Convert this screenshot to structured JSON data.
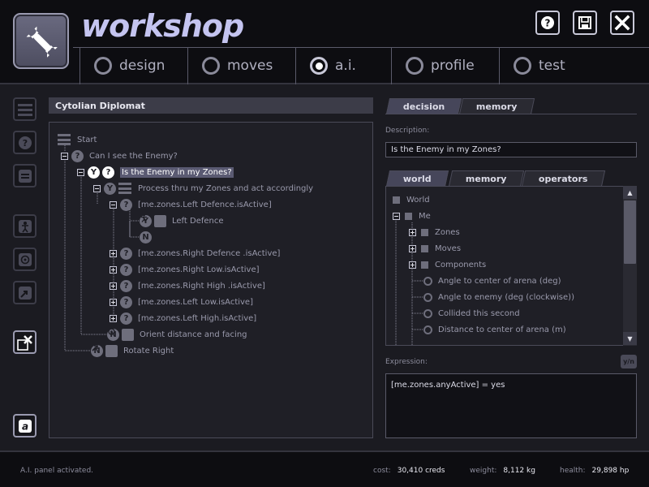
{
  "app": {
    "title": "workshop"
  },
  "header": {
    "help_icon": "help-icon",
    "save_icon": "save-icon",
    "close_icon": "close-icon"
  },
  "nav": {
    "tabs": [
      {
        "label": "design",
        "active": false
      },
      {
        "label": "moves",
        "active": false
      },
      {
        "label": "a.i.",
        "active": true
      },
      {
        "label": "profile",
        "active": false
      },
      {
        "label": "test",
        "active": false
      }
    ]
  },
  "toolbar": {
    "icons": [
      "list-icon",
      "question-icon",
      "equals-icon",
      "figure-icon",
      "target-icon",
      "action-icon",
      "delete-icon",
      "a-icon"
    ]
  },
  "tree": {
    "title": "Cytolian Diplomat",
    "rows": [
      {
        "text": "Start"
      },
      {
        "text": "Can I see the Enemy?"
      },
      {
        "text": "Is the Enemy in my Zones?"
      },
      {
        "text": "Process thru my Zones and act accordingly"
      },
      {
        "text": "[me.zones.Left Defence.isActive]"
      },
      {
        "text": "Left Defence"
      },
      {
        "text": ""
      },
      {
        "text": "[me.zones.Right Defence .isActive]"
      },
      {
        "text": "[me.zones.Right Low.isActive]"
      },
      {
        "text": "[me.zones.Right High .isActive]"
      },
      {
        "text": "[me.zones.Left Low.isActive]"
      },
      {
        "text": "[me.zones.Left High.isActive]"
      },
      {
        "text": "Orient distance and facing"
      },
      {
        "text": "Rotate Right"
      }
    ],
    "badges": {
      "y": "Y",
      "n": "N",
      "q": "?"
    }
  },
  "right": {
    "top_tabs": [
      {
        "label": "decision",
        "active": true
      },
      {
        "label": "memory",
        "active": false
      }
    ],
    "description_label": "Description:",
    "description_value": "Is the Enemy in my Zones?",
    "world_tabs": [
      {
        "label": "world",
        "active": true
      },
      {
        "label": "memory",
        "active": false
      },
      {
        "label": "operators",
        "active": false
      }
    ],
    "world_rows": [
      {
        "text": "World"
      },
      {
        "text": "Me"
      },
      {
        "text": "Zones"
      },
      {
        "text": "Moves"
      },
      {
        "text": "Components"
      },
      {
        "text": "Angle to center of arena (deg)"
      },
      {
        "text": "Angle to enemy (deg (clockwise))"
      },
      {
        "text": "Collided this second"
      },
      {
        "text": "Distance to center of arena (m)"
      }
    ],
    "expression_label": "Expression:",
    "yn_button": "y/n",
    "expression_value": "[me.zones.anyActive] = yes"
  },
  "status": {
    "message": "A.I. panel activated.",
    "cost_label": "cost:",
    "cost_value": "30,410 creds",
    "weight_label": "weight:",
    "weight_value": "8,112 kg",
    "health_label": "health:",
    "health_value": "29,898 hp"
  },
  "colors": {
    "accent": "#c4c4f0",
    "background": "#1b1b21",
    "selection": "#5a5a72"
  }
}
